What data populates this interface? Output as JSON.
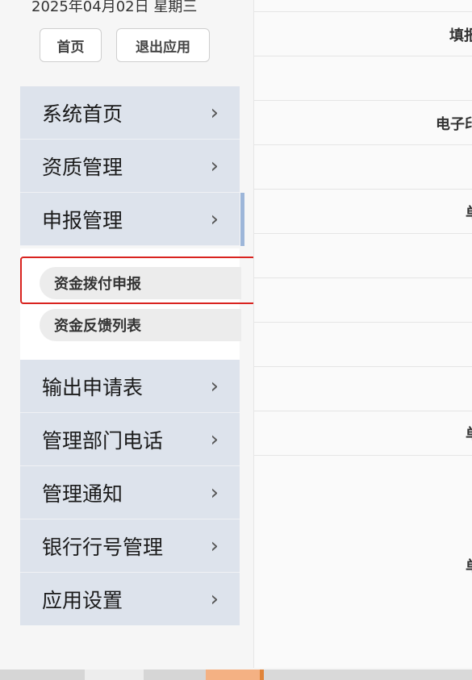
{
  "header": {
    "date_text": "2025年04月02日 星期三",
    "home_label": "首页",
    "exit_label": "退出应用"
  },
  "menu": {
    "top": [
      {
        "label": "系统首页"
      },
      {
        "label": "资质管理"
      },
      {
        "label": "申报管理",
        "active": true
      }
    ],
    "sub": [
      {
        "label": "资金拨付申报",
        "highlighted": true
      },
      {
        "label": "资金反馈列表"
      }
    ],
    "bottom": [
      {
        "label": "输出申请表"
      },
      {
        "label": "管理部门电话"
      },
      {
        "label": "管理通知"
      },
      {
        "label": "银行行号管理"
      },
      {
        "label": "应用设置"
      }
    ]
  },
  "right_panel": {
    "labels": [
      "填报",
      "电子印",
      "单",
      "单",
      "单"
    ]
  },
  "colors": {
    "menu_bg": "#dde3ec",
    "active_indicator": "#9db6d9",
    "highlight_border": "#d9231f"
  }
}
